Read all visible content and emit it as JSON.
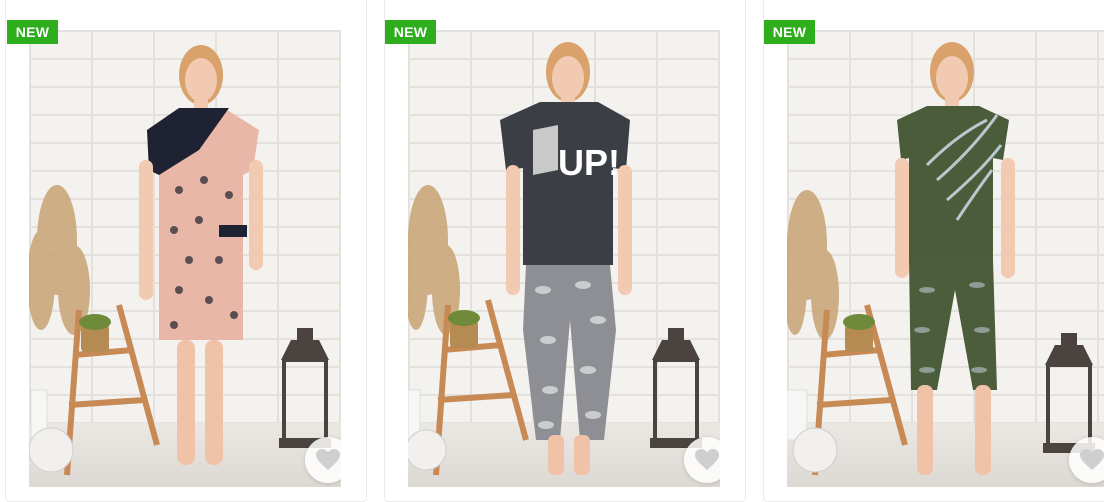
{
  "products": [
    {
      "badge": "NEW",
      "alt": "product-1",
      "favorite_icon": "heart-icon"
    },
    {
      "badge": "NEW",
      "alt": "product-2",
      "favorite_icon": "heart-icon"
    },
    {
      "badge": "NEW",
      "alt": "product-3",
      "favorite_icon": "heart-icon"
    }
  ],
  "colors": {
    "badge_bg": "#2eae1d",
    "badge_text": "#ffffff",
    "card_border": "#ececec"
  }
}
